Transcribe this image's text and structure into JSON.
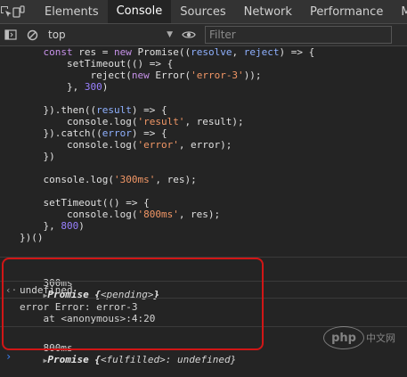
{
  "tabs": [
    "Elements",
    "Console",
    "Sources",
    "Network",
    "Performance",
    "M"
  ],
  "active_tab": "Console",
  "toolbar": {
    "context": "top",
    "filter_placeholder": "Filter"
  },
  "code_lines": [
    [
      {
        "t": "    "
      },
      {
        "t": "const",
        "c": "kw"
      },
      {
        "t": " res = "
      },
      {
        "t": "new",
        "c": "kw"
      },
      {
        "t": " Promise(("
      },
      {
        "t": "resolve",
        "c": "param"
      },
      {
        "t": ", "
      },
      {
        "t": "reject",
        "c": "param"
      },
      {
        "t": ") => {"
      }
    ],
    [
      {
        "t": "        setTimeout(() => {"
      }
    ],
    [
      {
        "t": "            reject("
      },
      {
        "t": "new",
        "c": "kw"
      },
      {
        "t": " Error("
      },
      {
        "t": "'error-3'",
        "c": "str"
      },
      {
        "t": "));"
      }
    ],
    [
      {
        "t": "        }, "
      },
      {
        "t": "300",
        "c": "num"
      },
      {
        "t": ")"
      }
    ],
    [
      {
        "t": ""
      }
    ],
    [
      {
        "t": "    }).then(("
      },
      {
        "t": "result",
        "c": "param"
      },
      {
        "t": ") => {"
      }
    ],
    [
      {
        "t": "        console.log("
      },
      {
        "t": "'result'",
        "c": "str"
      },
      {
        "t": ", result);"
      }
    ],
    [
      {
        "t": "    }).catch(("
      },
      {
        "t": "error",
        "c": "param"
      },
      {
        "t": ") => {"
      }
    ],
    [
      {
        "t": "        console.log("
      },
      {
        "t": "'error'",
        "c": "str"
      },
      {
        "t": ", error);"
      }
    ],
    [
      {
        "t": "    })"
      }
    ],
    [
      {
        "t": ""
      }
    ],
    [
      {
        "t": "    console.log("
      },
      {
        "t": "'300ms'",
        "c": "str"
      },
      {
        "t": ", res);"
      }
    ],
    [
      {
        "t": ""
      }
    ],
    [
      {
        "t": "    setTimeout(() => {"
      }
    ],
    [
      {
        "t": "        console.log("
      },
      {
        "t": "'800ms'",
        "c": "str"
      },
      {
        "t": ", res);"
      }
    ],
    [
      {
        "t": "    }, "
      },
      {
        "t": "800",
        "c": "num"
      },
      {
        "t": ")"
      }
    ],
    [
      {
        "t": "})()"
      }
    ]
  ],
  "messages": {
    "m1_label": "300ms",
    "m1_obj": "Promise {",
    "m1_state": "<pending>",
    "m1_end": "}",
    "m2_text": "undefined",
    "m3_line1": "error Error: error-3",
    "m3_line2": "    at <anonymous>:4:20",
    "m4_label": "800ms",
    "m4_obj": "Promise {",
    "m4_state": "<fulfilled>",
    "m4_tail": ": undefined}"
  },
  "watermark": {
    "brand": "php",
    "site": "中文网"
  },
  "colors": {
    "highlight_border": "#d11616",
    "background": "#242424"
  }
}
